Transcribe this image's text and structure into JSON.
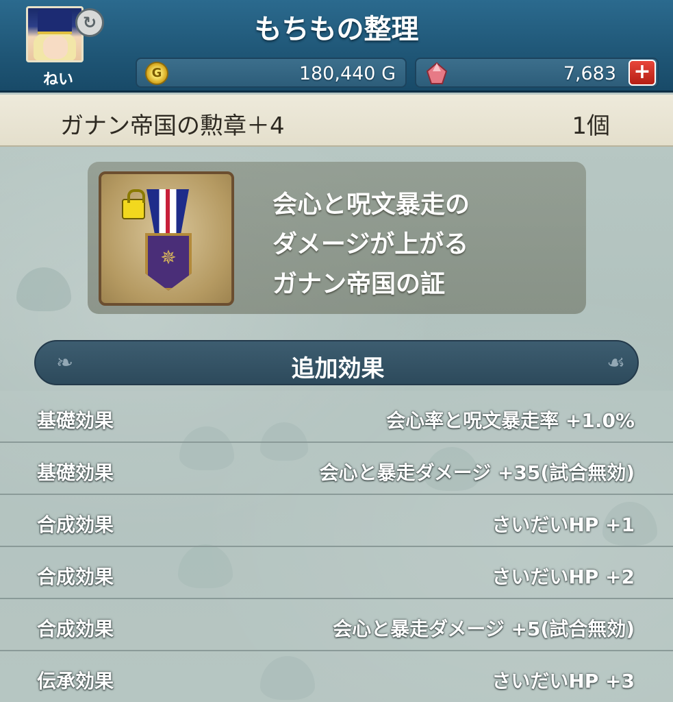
{
  "header": {
    "title": "もちもの整理",
    "player_name": "ねい",
    "gold": "180,440 G",
    "gold_icon_glyph": "G",
    "gems": "7,683",
    "plus_glyph": "+",
    "swap_glyph": "↻"
  },
  "item": {
    "name": "ガナン帝国の勲章＋4",
    "count": "1個",
    "description": [
      "会心と呪文暴走の",
      "ダメージが上がる",
      "ガナン帝国の証"
    ]
  },
  "section": {
    "title": "追加効果"
  },
  "effects": [
    {
      "label": "基礎効果",
      "value": "会心率と呪文暴走率 +1.0%"
    },
    {
      "label": "基礎効果",
      "value": "会心と暴走ダメージ +35(試合無効)"
    },
    {
      "label": "合成効果",
      "value": "さいだいHP +1"
    },
    {
      "label": "合成効果",
      "value": "さいだいHP +2"
    },
    {
      "label": "合成効果",
      "value": "会心と暴走ダメージ +5(試合無効)"
    },
    {
      "label": "伝承効果",
      "value": "さいだいHP +3"
    }
  ],
  "colors": {
    "header_bg": "#1f5676",
    "item_bar_bg": "#eeeadb",
    "plus_button": "#d9362b"
  }
}
